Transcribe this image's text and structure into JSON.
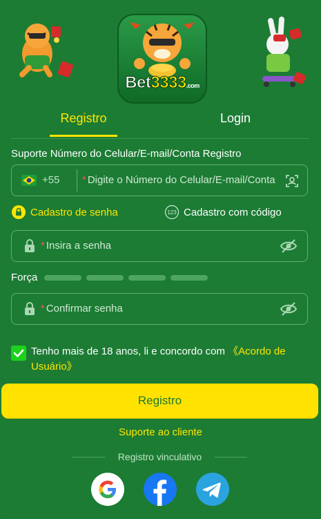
{
  "brand": {
    "logo_main": "Bet",
    "logo_num": "3333",
    "logo_domain": ".com"
  },
  "tabs": [
    {
      "label": "Registro",
      "active": true
    },
    {
      "label": "Login",
      "active": false
    }
  ],
  "form": {
    "account_label": "Suporte Número do Celular/E-mail/Conta Registro",
    "country_code": "+55",
    "account_placeholder": "Digite o Número do Celular/E-mail/Conta",
    "mode_password": "Cadastro de senha",
    "mode_code": "Cadastro com código",
    "mode_code_icon_text": "123",
    "password_placeholder": "Insira a senha",
    "strength_label": "Força",
    "confirm_placeholder": "Confirmar senha",
    "required_mark": "*",
    "agree_text": "Tenho mais de 18 anos, li e concordo com ",
    "agree_link": "《Acordo de Usuário》",
    "agree_checked": true,
    "submit_label": "Registro"
  },
  "support_label": "Suporte ao cliente",
  "social": {
    "divider_label": "Registro vinculativo",
    "providers": [
      "google-icon",
      "facebook-icon",
      "telegram-icon"
    ]
  },
  "colors": {
    "background": "#1c7c34",
    "accent": "#ffe600",
    "button": "#ffe200",
    "check": "#1dd11d"
  }
}
